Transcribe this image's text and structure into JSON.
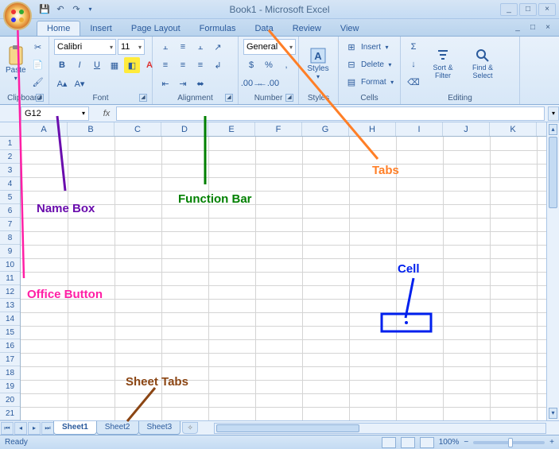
{
  "titlebar": {
    "title": "Book1 - Microsoft Excel",
    "qat_save": "💾",
    "qat_undo": "↶",
    "qat_redo": "↷"
  },
  "tabs": [
    "Home",
    "Insert",
    "Page Layout",
    "Formulas",
    "Data",
    "Review",
    "View"
  ],
  "active_tab": "Home",
  "ribbon": {
    "clipboard": {
      "label": "Clipboard",
      "paste": "Paste"
    },
    "font": {
      "label": "Font",
      "name": "Calibri",
      "size": "11"
    },
    "alignment": {
      "label": "Alignment"
    },
    "number": {
      "label": "Number",
      "format": "General"
    },
    "styles": {
      "label": "Styles",
      "btn": "Styles"
    },
    "cells": {
      "label": "Cells",
      "insert": "Insert",
      "delete": "Delete",
      "format": "Format"
    },
    "editing": {
      "label": "Editing",
      "sort": "Sort & Filter",
      "find": "Find & Select"
    }
  },
  "formula_bar": {
    "namebox": "G12",
    "fx": "fx"
  },
  "columns": [
    "A",
    "B",
    "C",
    "D",
    "E",
    "F",
    "G",
    "H",
    "I",
    "J",
    "K"
  ],
  "rows": [
    "1",
    "2",
    "3",
    "4",
    "5",
    "6",
    "7",
    "8",
    "9",
    "10",
    "11",
    "12",
    "13",
    "14",
    "15",
    "16",
    "17",
    "18",
    "19",
    "20",
    "21"
  ],
  "sheet_tabs": [
    "Sheet1",
    "Sheet2",
    "Sheet3"
  ],
  "active_sheet": 0,
  "status": {
    "ready": "Ready",
    "zoom": "100%"
  },
  "annotations": {
    "office_button": "Office Button",
    "name_box": "Name Box",
    "function_bar": "Function Bar",
    "tabs": "Tabs",
    "cell": "Cell",
    "sheet_tabs": "Sheet Tabs"
  },
  "colors": {
    "anno_office": "#ff1fa5",
    "anno_namebox": "#6a0dad",
    "anno_function": "#008000",
    "anno_tabs": "#ff7f27",
    "anno_cell": "#0020ee",
    "anno_sheet": "#8b4513"
  }
}
